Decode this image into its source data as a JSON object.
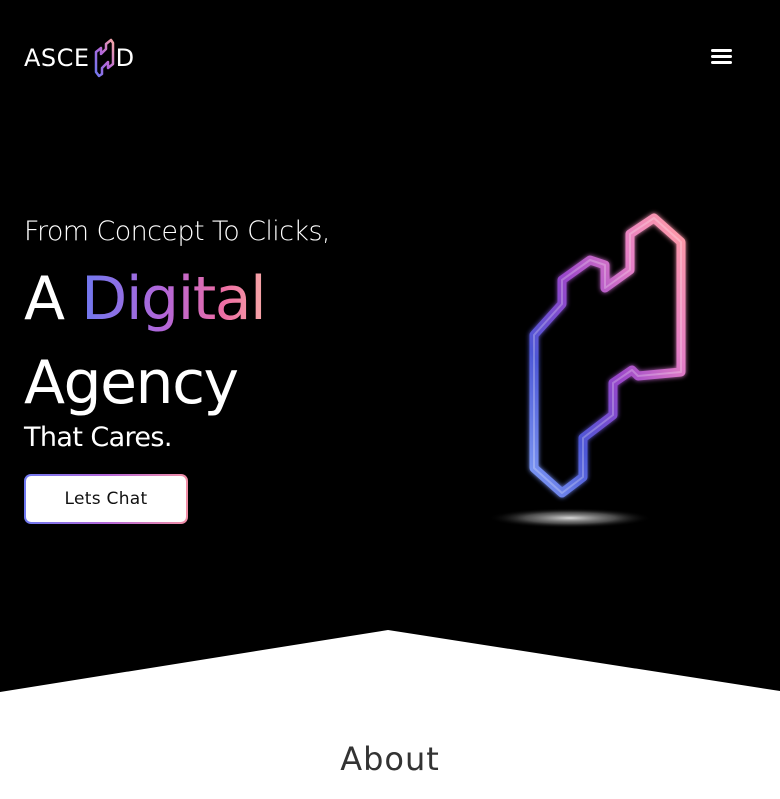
{
  "brand": {
    "logo_left": "ASCE",
    "logo_right": "D",
    "logo_mark_icon": "ascend-n-mark-icon"
  },
  "header": {
    "menu_icon": "hamburger-menu-icon"
  },
  "hero": {
    "tagline": "From Concept To Clicks,",
    "headline_prefix": "A",
    "headline_highlight": "Digital",
    "headline_line2": "Agency",
    "subline": "That Cares.",
    "cta_label": "Lets Chat",
    "graphic_icon": "neon-ascend-logo-icon"
  },
  "about": {
    "title": "About"
  },
  "colors": {
    "hero_background": "#000000",
    "gradient_start": "#6f79f0",
    "gradient_mid": "#b366d8",
    "gradient_end": "#f6a7a6",
    "page_background": "#ffffff"
  }
}
